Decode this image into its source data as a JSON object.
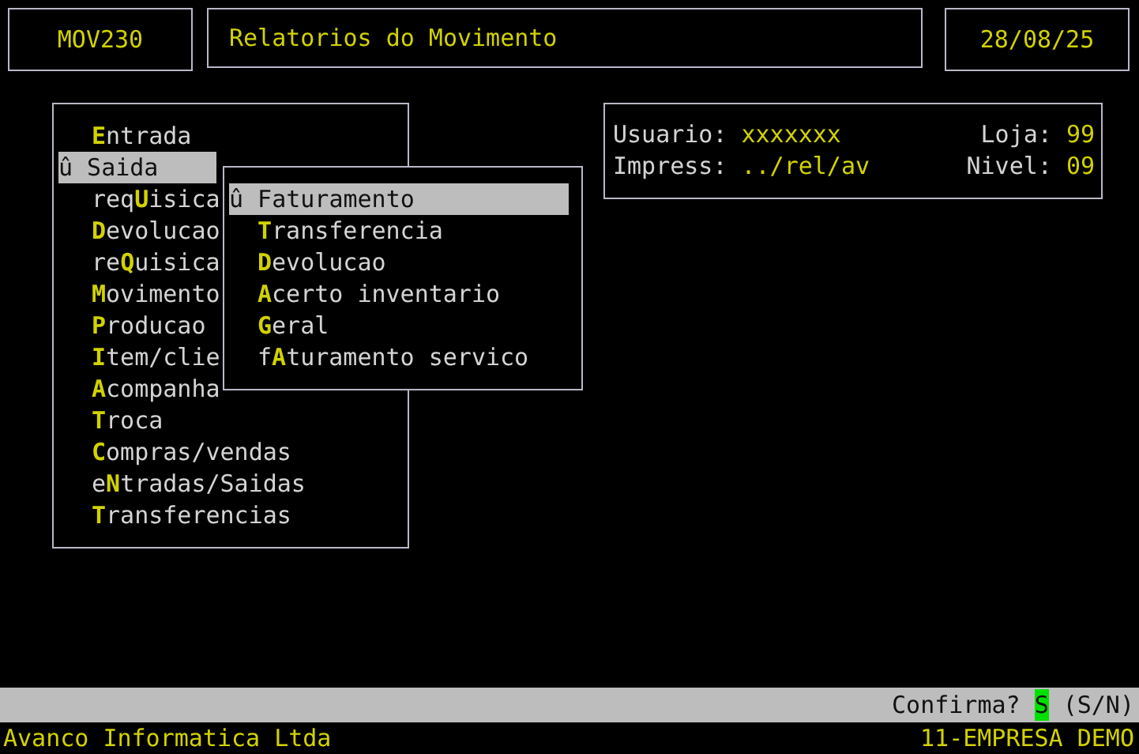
{
  "header": {
    "program": "MOV230",
    "title": "Relatorios do Movimento",
    "date": "28/08/25"
  },
  "menu": {
    "items": [
      {
        "label": "**E**ntrada",
        "selected": false
      },
      {
        "label": "û Saida",
        "selected": true
      },
      {
        "label": "req**U**isica",
        "selected": false
      },
      {
        "label": "**D**evolucao",
        "selected": false
      },
      {
        "label": "re**Q**uisica",
        "selected": false
      },
      {
        "label": "**M**ovimento",
        "selected": false
      },
      {
        "label": "**P**roducao",
        "selected": false
      },
      {
        "label": "**I**tem/clie",
        "selected": false
      },
      {
        "label": "**A**companha",
        "selected": false
      },
      {
        "label": "**T**roca",
        "selected": false
      },
      {
        "label": "**C**ompras/vendas",
        "selected": false
      },
      {
        "label": "e**N**tradas/Saidas",
        "selected": false
      },
      {
        "label": "**T**ransferencias",
        "selected": false
      }
    ]
  },
  "submenu": {
    "items": [
      {
        "label": "û Faturamento",
        "selected": true
      },
      {
        "label": "**T**ransferencia",
        "selected": false
      },
      {
        "label": "**D**evolucao",
        "selected": false
      },
      {
        "label": "**A**certo inventario",
        "selected": false
      },
      {
        "label": "**G**eral",
        "selected": false
      },
      {
        "label": "f**A**turamento servico",
        "selected": false
      }
    ]
  },
  "info": {
    "rows": [
      {
        "label": "Usuario:",
        "value": "xxxxxxx",
        "right_label": "Loja:",
        "right_value": "99"
      },
      {
        "label": "Impress:",
        "value": "../rel/av",
        "right_label": "Nivel:",
        "right_value": "09"
      }
    ]
  },
  "prompt": {
    "text": "Confirma?",
    "answer": "S",
    "options": "(S/N)"
  },
  "status_bar": {
    "left": "Avanco Informatica Ltda",
    "right": "11-EMPRESA DEMO"
  }
}
